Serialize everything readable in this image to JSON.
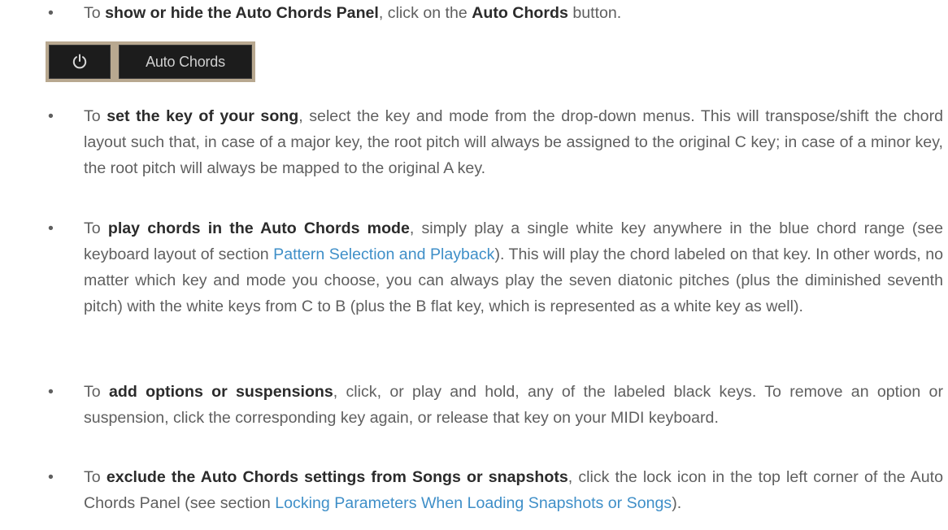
{
  "bullet_glyph": "•",
  "buttons": {
    "power_icon": "power-icon",
    "auto_chords_label": "Auto Chords"
  },
  "colors": {
    "text": "#5f5f5f",
    "bold": "#2b2b2b",
    "link": "#3f8fc8",
    "button_bg": "#1c1c1c",
    "button_frame": "#b8a890"
  },
  "items": [
    {
      "pre": "To ",
      "bold": "show or hide the Auto Chords Panel",
      "mid": ", click on the ",
      "bold2": "Auto Chords",
      "post": " button."
    },
    {
      "pre": "To ",
      "bold": "set the key of your song",
      "post": ", select the key and mode from the drop-down menus. This will transpose/shift the chord layout such that, in case of a major key, the root pitch will always be assigned to the original C key; in case of a minor key, the root pitch will always be mapped to the original A key."
    },
    {
      "pre": "To ",
      "bold": "play chords in the Auto Chords mode",
      "mid": ", simply play a single white key anywhere in the blue chord range (see keyboard layout of section ",
      "link": "Pattern Selection and Playback",
      "post": "). This will play the chord labeled on that key. In other words, no matter which key and mode you choose, you can always play the seven diatonic pitches (plus the diminished seventh pitch) with the white keys from C to B (plus the B flat key, which is represented as a white key as well)."
    },
    {
      "pre": "To ",
      "bold": "add options or suspensions",
      "post": ", click, or play and hold, any of the labeled black keys. To remove an option or suspension, click the corresponding key again, or release that key on your MIDI keyboard."
    },
    {
      "pre": "To ",
      "bold": "exclude the Auto Chords settings from Songs or snapshots",
      "mid": ", click the lock icon in the top left corner of the Auto Chords Panel (see section ",
      "link": "Locking Parameters When Loading Snapshots or Songs",
      "post": ")."
    }
  ]
}
